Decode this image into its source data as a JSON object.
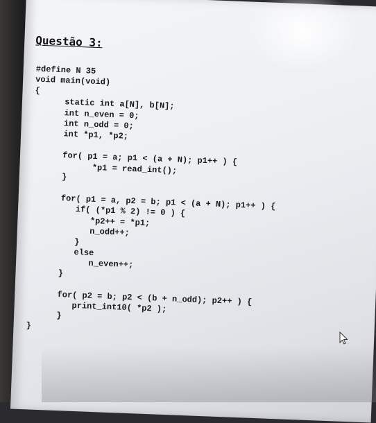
{
  "heading": "Questão 3:",
  "code_lines": [
    "#define N 35",
    "void main(void)",
    "{",
    "      static int a[N], b[N];",
    "      int n_even = 0;",
    "      int n_odd = 0;",
    "      int *p1, *p2;",
    "",
    "      for( p1 = a; p1 < (a + N); p1++ ) {",
    "            *p1 = read_int();",
    "      }",
    "",
    "      for( p1 = a, p2 = b; p1 < (a + N); p1++ ) {",
    "         if( (*p1 % 2) != 0 ) {",
    "            *p2++ = *p1;",
    "            n_odd++;",
    "         }",
    "         else",
    "            n_even++;",
    "      }",
    "",
    "      for( p2 = b; p2 < (b + n_odd); p2++ ) {",
    "         print_int10( *p2 );",
    "      }",
    "}"
  ],
  "cursor_icon": "mouse-pointer-icon"
}
